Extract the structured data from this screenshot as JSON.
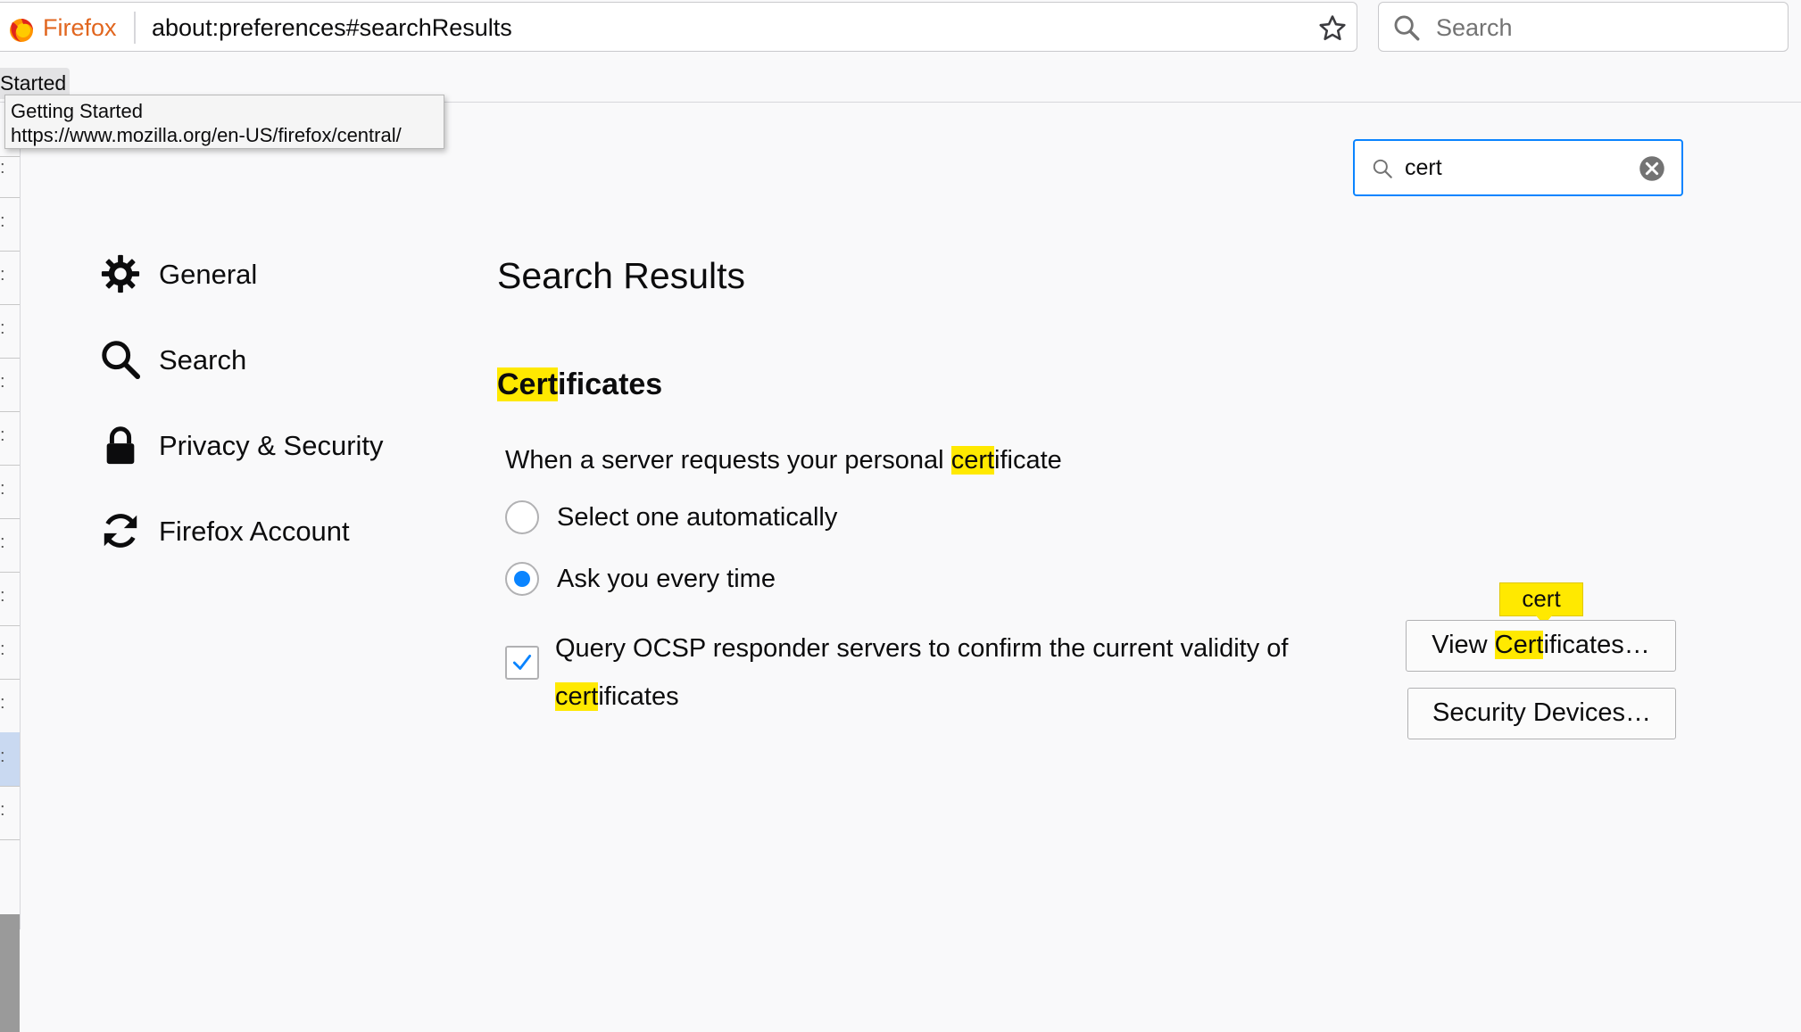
{
  "browser": {
    "brand": "Firefox",
    "url": "about:preferences#searchResults",
    "search_placeholder": "Search"
  },
  "bookmarks": {
    "item_label": "Started"
  },
  "tooltip": {
    "title": "Getting Started",
    "url": "https://www.mozilla.org/en-US/firefox/central/"
  },
  "prefs_search": {
    "value": "cert"
  },
  "categories": [
    {
      "label": "General",
      "icon": "gear-icon"
    },
    {
      "label": "Search",
      "icon": "search-icon"
    },
    {
      "label": "Privacy & Security",
      "icon": "lock-icon"
    },
    {
      "label": "Firefox Account",
      "icon": "sync-icon"
    }
  ],
  "results": {
    "title": "Search Results",
    "section_hl": "Cert",
    "section_rest": "ificates",
    "desc_pre": "When a server requests your personal ",
    "desc_hl": "cert",
    "desc_post": "ificate",
    "radio_auto": "Select one automatically",
    "radio_ask": "Ask you every time",
    "ocsp_pre": "Query OCSP responder servers to confirm the current validity of ",
    "ocsp_hl": "cert",
    "ocsp_post": "ificates",
    "btn_view_pre": "View ",
    "btn_view_hl": "Cert",
    "btn_view_post": "ificates…",
    "btn_security": "Security Devices…",
    "badge": "cert"
  },
  "colors": {
    "accent": "#0a84ff",
    "highlight": "#ffe900",
    "firefox_orange": "#e1661f"
  }
}
